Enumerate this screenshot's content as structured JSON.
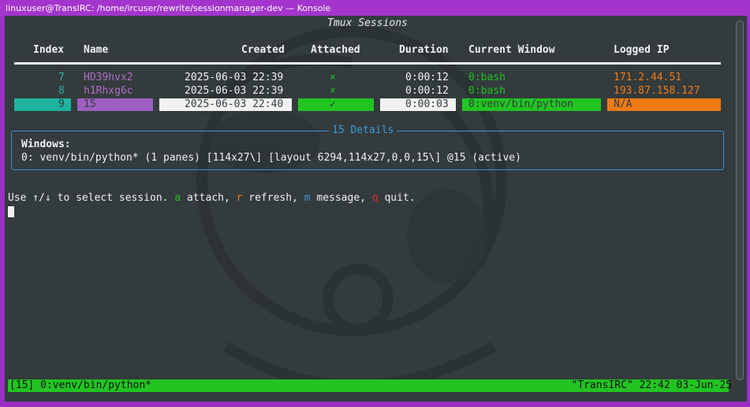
{
  "window": {
    "title": "linuxuser@TransIRC: /home/ircuser/rewrite/sessionmanager-dev — Konsole"
  },
  "app": {
    "heading": "Tmux Sessions"
  },
  "table": {
    "headers": {
      "index": "Index",
      "name": "Name",
      "created": "Created",
      "attached": "Attached",
      "duration": "Duration",
      "window": "Current Window",
      "ip": "Logged IP"
    },
    "rows": [
      {
        "index": "7",
        "name": "HD39hvx2",
        "created": "2025-06-03 22:39",
        "attached": "×",
        "duration": "0:00:12",
        "window": "0:bash",
        "ip": "171.2.44.51",
        "selected": false
      },
      {
        "index": "8",
        "name": "h1Rhxg6c",
        "created": "2025-06-03 22:39",
        "attached": "×",
        "duration": "0:00:12",
        "window": "0:bash",
        "ip": "193.87.158.127",
        "selected": false
      },
      {
        "index": "9",
        "name": "15",
        "created": "2025-06-03 22:40",
        "attached": "✓",
        "duration": "0:00:03",
        "window": "0:venv/bin/python",
        "ip": "N/A",
        "selected": true
      }
    ]
  },
  "details": {
    "title": "15 Details",
    "label": "Windows:",
    "line": "0: venv/bin/python* (1 panes) [114x27\\] [layout 6294,114x27,0,0,15\\] @15 (active)"
  },
  "help": {
    "prefix": "Use ↑/↓ to select session. ",
    "attach_key": "a",
    "attach_text": " attach, ",
    "refresh_key": "r",
    "refresh_text": " refresh, ",
    "message_key": "m",
    "message_text": " message, ",
    "quit_key": "q",
    "quit_text": " quit."
  },
  "status": {
    "left": "[15] 0:venv/bin/python*",
    "right": "\"TransIRC\" 22:42 03-Jun-25"
  },
  "colors": {
    "titlebar": "#a335cc",
    "terminal_bg": "#333b3d",
    "accent_blue": "#3c9ad9",
    "status_green": "#22c422",
    "name_purple": "#b06ec6",
    "index_teal": "#24b0a0",
    "ip_orange": "#f07b14",
    "attached_green": "#20c020"
  }
}
